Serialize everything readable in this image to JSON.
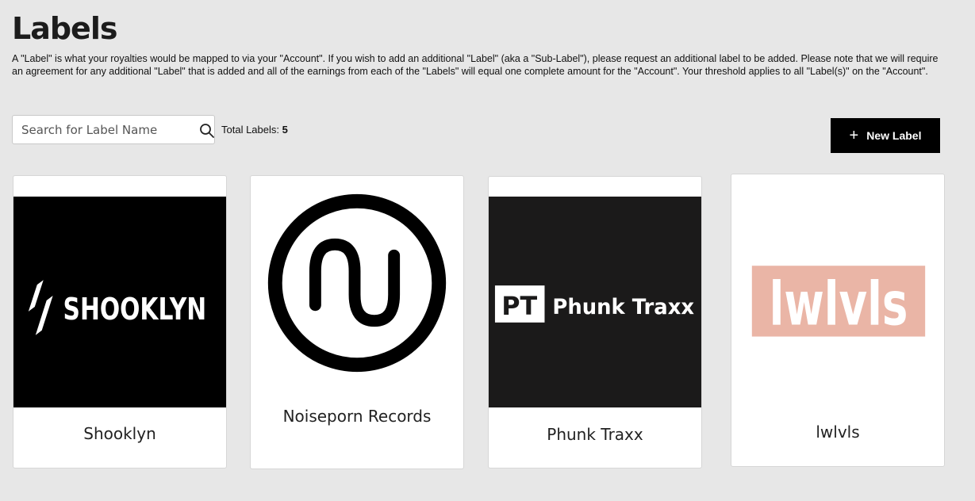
{
  "page": {
    "title": "Labels",
    "description": "A \"Label\" is what your royalties would be mapped to via your \"Account\". If you wish to add an additional \"Label\" (aka a \"Sub-Label\"), please request an additional label to be added. Please note that we will require an agreement for any additional \"Label\" that is added and all of the earnings from each of the \"Labels\" will equal one complete amount for the \"Account\". Your threshold applies to all \"Label(s)\" on the \"Account\"."
  },
  "search": {
    "placeholder": "Search for Label Name",
    "icon": "search-icon"
  },
  "totals": {
    "label": "Total Labels: ",
    "count": "5"
  },
  "new_label_button": {
    "label": "New Label",
    "icon": "plus-icon"
  },
  "labels": [
    {
      "name": "Shooklyn",
      "logo_text": "SHOOKLYN",
      "logo_bg": "#000000"
    },
    {
      "name": "Noiseporn Records",
      "logo_bg": "#ffffff"
    },
    {
      "name": "Phunk Traxx",
      "logo_text": "Phunk Traxx",
      "badge_text": "PT",
      "logo_bg": "#1b1a1a"
    },
    {
      "name": "lwlvls",
      "logo_text": "lwlvls",
      "logo_bg": "#eab5a6"
    }
  ]
}
